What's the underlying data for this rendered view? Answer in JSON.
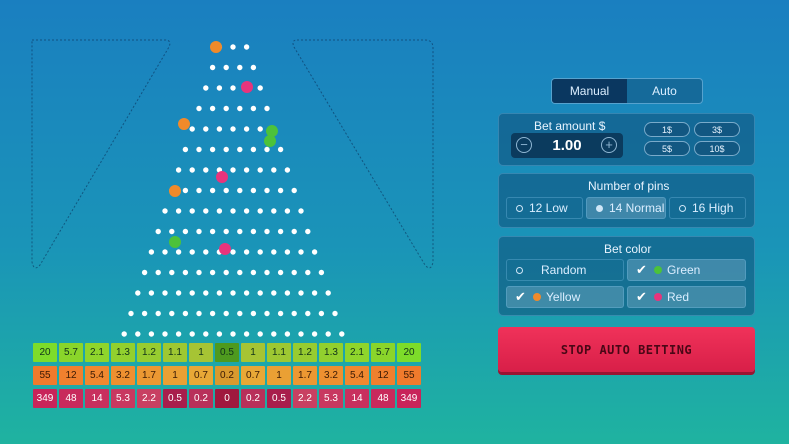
{
  "board": {
    "pins": 14,
    "balls": [
      {
        "color": "#f08a2a"
      },
      {
        "color": "#e8347c"
      },
      {
        "color": "#f08a2a"
      },
      {
        "color": "#4cc23a"
      },
      {
        "color": "#4cc23a"
      },
      {
        "color": "#e8347c"
      },
      {
        "color": "#f08a2a"
      },
      {
        "color": "#4cc23a"
      },
      {
        "color": "#e8347c"
      }
    ]
  },
  "multipliers": {
    "rows": [
      [
        "20",
        "5.7",
        "2.1",
        "1.3",
        "1.2",
        "1.1",
        "1",
        "0.5",
        "1",
        "1.1",
        "1.2",
        "1.3",
        "2.1",
        "5.7",
        "20"
      ],
      [
        "55",
        "12",
        "5.4",
        "3.2",
        "1.7",
        "1",
        "0.7",
        "0.2",
        "0.7",
        "1",
        "1.7",
        "3.2",
        "5.4",
        "12",
        "55"
      ],
      [
        "349",
        "48",
        "14",
        "5.3",
        "2.2",
        "0.5",
        "0.2",
        "0",
        "0.2",
        "0.5",
        "2.2",
        "5.3",
        "14",
        "48",
        "349"
      ]
    ],
    "row_colors": [
      [
        "#7ddc2a",
        "#8ad52a",
        "#8fd52c",
        "#92d02e",
        "#97cc30",
        "#9ec832",
        "#a6c434",
        "#4e9a1e",
        "#a6c434",
        "#9ec832",
        "#97cc30",
        "#92d02e",
        "#8fd52c",
        "#8ad52a",
        "#7ddc2a"
      ],
      [
        "#f07a2c",
        "#f0802e",
        "#f08830",
        "#ee9030",
        "#ec9832",
        "#eaa034",
        "#e8a836",
        "#d99a2e",
        "#e8a836",
        "#eaa034",
        "#ec9832",
        "#ee9030",
        "#f08830",
        "#f0802e",
        "#f07a2c"
      ],
      [
        "#c8245a",
        "#c82a5c",
        "#c8305e",
        "#c83860",
        "#c84062",
        "#a81e4c",
        "#b8305a",
        "#a0183e",
        "#b8305a",
        "#a81e4c",
        "#c84062",
        "#c83860",
        "#c8305e",
        "#c82a5c",
        "#c8245a"
      ]
    ]
  },
  "mode_toggle": {
    "manual": "Manual",
    "auto": "Auto",
    "active": "manual"
  },
  "bet": {
    "title": "Bet amount $",
    "value": "1.00",
    "minus": "−",
    "plus": "+",
    "chips": [
      "1$",
      "3$",
      "5$",
      "10$"
    ]
  },
  "pins_panel": {
    "title": "Number of pins",
    "options": [
      "12 Low",
      "14 Normal",
      "16 High"
    ],
    "selected": "14 Normal"
  },
  "color_panel": {
    "title": "Bet color",
    "options": [
      {
        "label": "Random",
        "checked": false,
        "dot": ""
      },
      {
        "label": "Green",
        "checked": true,
        "dot": "#4cc23a"
      },
      {
        "label": "Yellow",
        "checked": true,
        "dot": "#f08a2a"
      },
      {
        "label": "Red",
        "checked": true,
        "dot": "#e8347c"
      }
    ]
  },
  "action": {
    "stop_label": "STOP AUTO BETTING"
  }
}
